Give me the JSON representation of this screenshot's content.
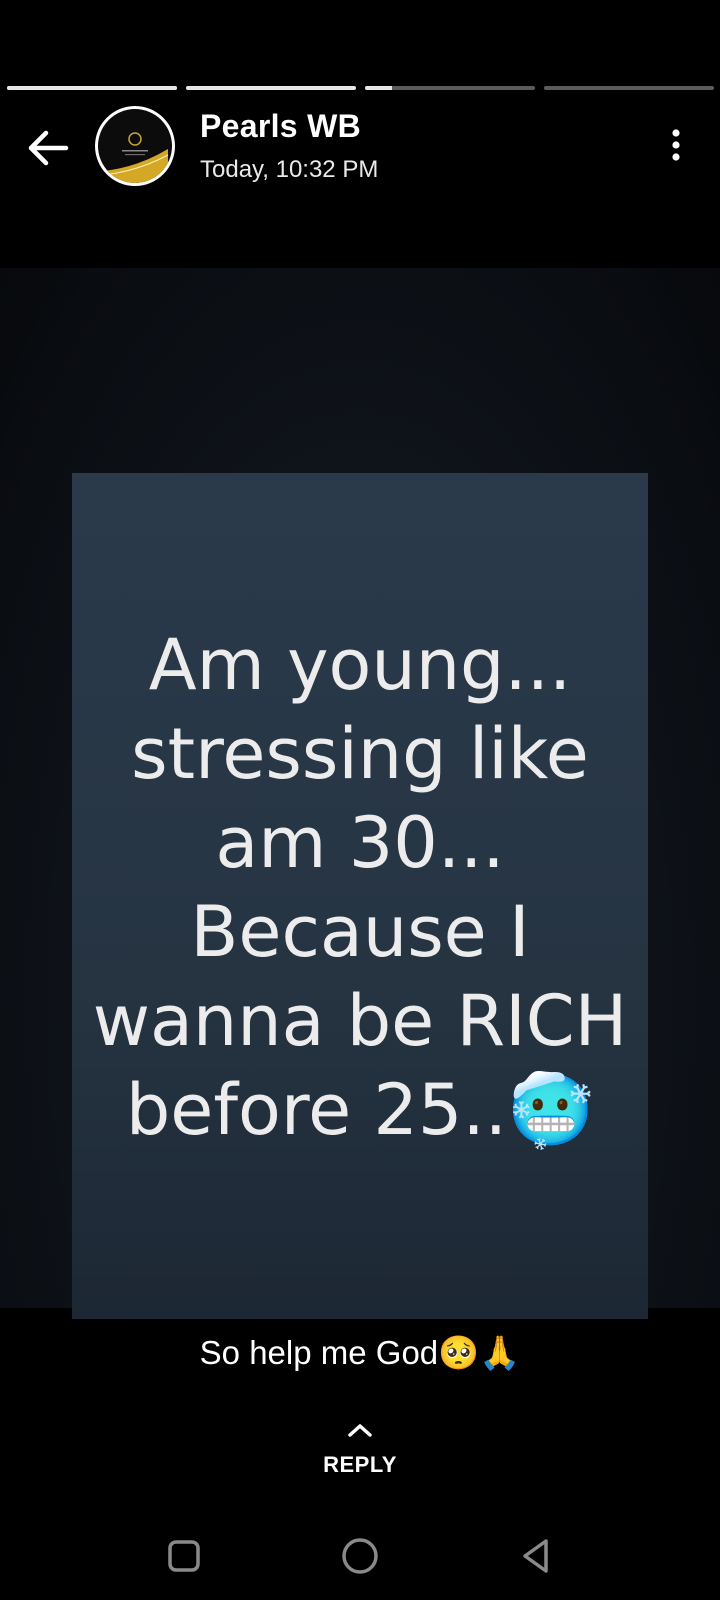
{
  "story": {
    "segments": [
      {
        "progress": 1.0
      },
      {
        "progress": 1.0
      },
      {
        "progress": 0.16
      },
      {
        "progress": 0.0
      }
    ]
  },
  "header": {
    "contact_name": "Pearls WB",
    "timestamp": "Today, 10:32 PM",
    "back_icon": "arrow-left-icon",
    "menu_icon": "more-vertical-icon"
  },
  "media": {
    "quote_text": "Am young...\nstressing like\nam 30...\nBecause I\nwanna be RICH\nbefore 25..🥶"
  },
  "caption": "So help me God🥺🙏",
  "reply": {
    "label": "REPLY",
    "icon": "chevron-up-icon"
  },
  "nav": {
    "recents_icon": "square-icon",
    "home_icon": "circle-icon",
    "back_icon": "triangle-back-icon"
  },
  "colors": {
    "background": "#000000",
    "card": "#283848",
    "progress_active": "#e6e6e6",
    "progress_inactive": "#5b5b5b"
  }
}
